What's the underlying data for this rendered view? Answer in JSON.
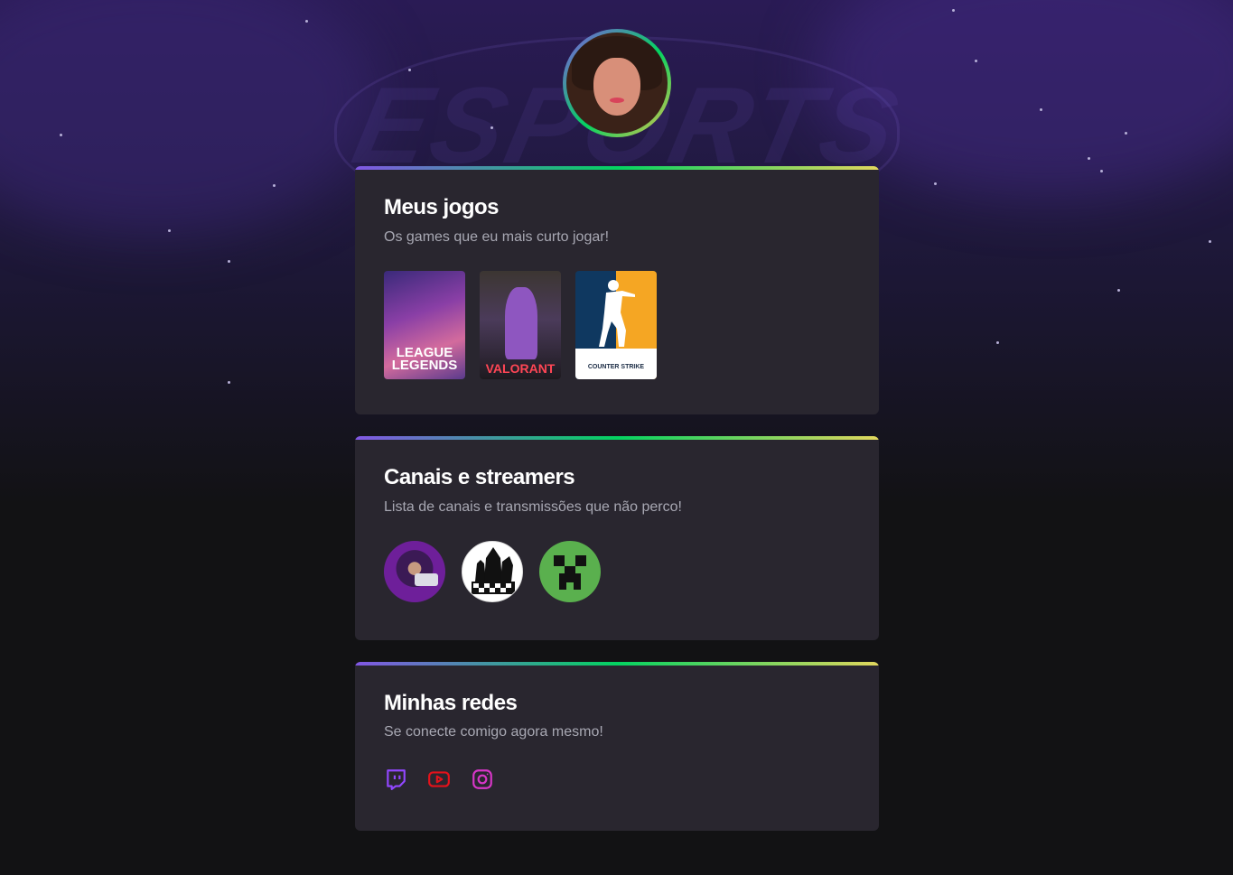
{
  "avatar": {
    "alt": "profile photo"
  },
  "cards": {
    "games": {
      "title": "Meus jogos",
      "subtitle": "Os games que eu mais curto jogar!",
      "items": [
        {
          "name": "LEAGUE OF LEGENDS",
          "logo_line1": "LEAGUE",
          "logo_line2": "LEGENDS",
          "icon": "league-of-legends-cover"
        },
        {
          "name": "VALORANT",
          "logo": "VALORANT",
          "icon": "valorant-cover"
        },
        {
          "name": "COUNTER STRIKE",
          "logo": "COUNTER STRIKE",
          "icon": "counter-strike-cover"
        }
      ]
    },
    "channels": {
      "title": "Canais e streamers",
      "subtitle": "Lista de canais e transmissões que não perco!",
      "items": [
        {
          "icon": "streamer-avatar"
        },
        {
          "icon": "chess-avatar"
        },
        {
          "icon": "minecraft-creeper-avatar"
        }
      ]
    },
    "social": {
      "title": "Minhas redes",
      "subtitle": "Se conecte comigo agora mesmo!",
      "items": [
        {
          "icon": "twitch-icon",
          "color": "#9147ff"
        },
        {
          "icon": "youtube-icon",
          "color": "#e3121b"
        },
        {
          "icon": "instagram-icon",
          "color": "#d836c8"
        }
      ]
    }
  },
  "colors": {
    "card_bg": "#29262f",
    "gradient_start": "#8257e5",
    "gradient_mid": "#04d361",
    "gradient_end": "#e1d75e"
  }
}
